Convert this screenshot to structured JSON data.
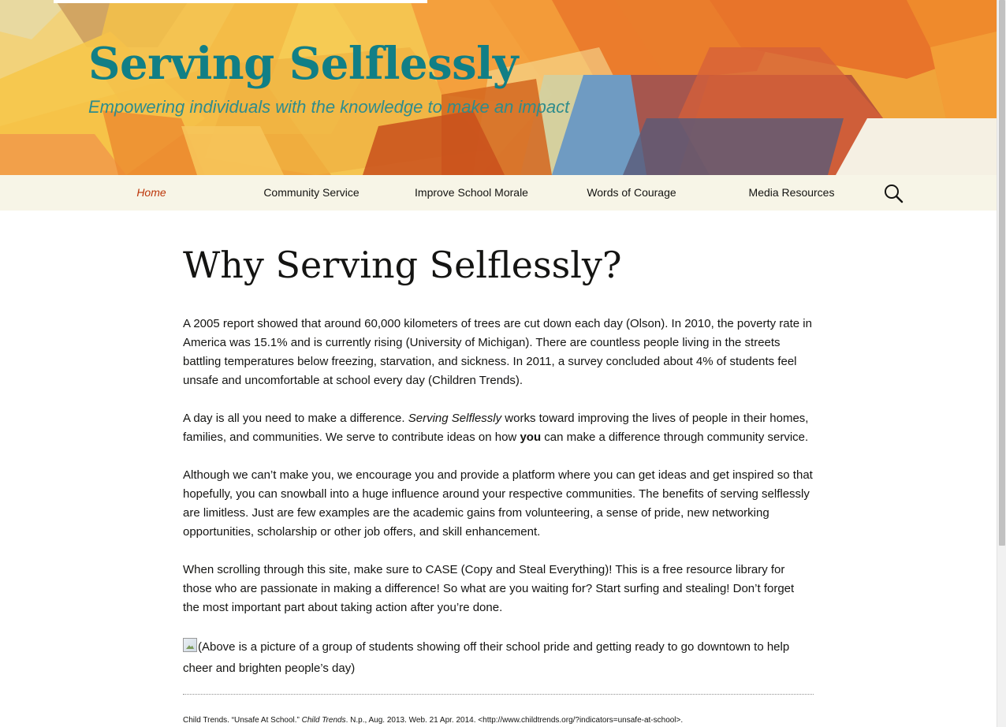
{
  "header": {
    "site_title": "Serving Selflessly",
    "tagline": "Empowering individuals with the knowledge to make an impact"
  },
  "nav": {
    "items": [
      {
        "label": "Home",
        "current": true
      },
      {
        "label": "Community Service",
        "current": false
      },
      {
        "label": "Improve School Morale",
        "current": false
      },
      {
        "label": "Words of Courage",
        "current": false
      },
      {
        "label": "Media Resources",
        "current": false
      }
    ],
    "search_icon": "search-icon"
  },
  "post": {
    "title": "Why Serving Selflessly?",
    "p1": "A 2005 report showed that around 60,000 kilometers of trees are cut down each day (Olson). In 2010, the poverty rate in America was 15.1% and is currently rising (University of Michigan). There are countless people living in the streets battling temperatures below freezing, starvation, and sickness. In 2011, a survey concluded about 4% of students feel unsafe and uncomfortable at school every day (Children Trends).",
    "p2_before": "A day is all you need to make a difference. ",
    "p2_em": "Serving Selflessly",
    "p2_mid": " works toward improving the lives of people in their homes, families, and communities. We serve to contribute ideas on how ",
    "p2_strong": "you",
    "p2_after": " can make a difference through community service.",
    "p3": "Although we can’t make you, we encourage you and provide a platform where you can get ideas and get inspired so that hopefully, you can snowball into a huge influence around your respective communities. The benefits of serving selflessly are limitless. Just are few examples are the academic gains from volunteering, a sense of pride, new networking opportunities, scholarship or other job offers, and skill enhancement.",
    "p4": "When scrolling through this site, make sure to CASE (Copy and Steal Everything)! This is a free resource library for those who are passionate in making a difference! So what are you waiting for? Start surfing and stealing! Don’t forget the most important part about taking action after you’re done.",
    "photo_caption": "(Above is a picture of a group of students showing off their school pride and getting ready to go downtown to help cheer and brighten people’s day)"
  },
  "citation": {
    "before": "Child Trends. “Unsafe At School.” ",
    "em": "Child Trends",
    "after": ". N.p., Aug. 2013. Web. 21 Apr. 2014. <http://www.childtrends.org/?indicators=unsafe-at-school>."
  },
  "colors": {
    "title_teal": "#117f86",
    "tagline_teal": "#2f8c8c",
    "nav_bg": "#f7f5e7",
    "nav_current": "#bc360a",
    "text": "#141412"
  }
}
